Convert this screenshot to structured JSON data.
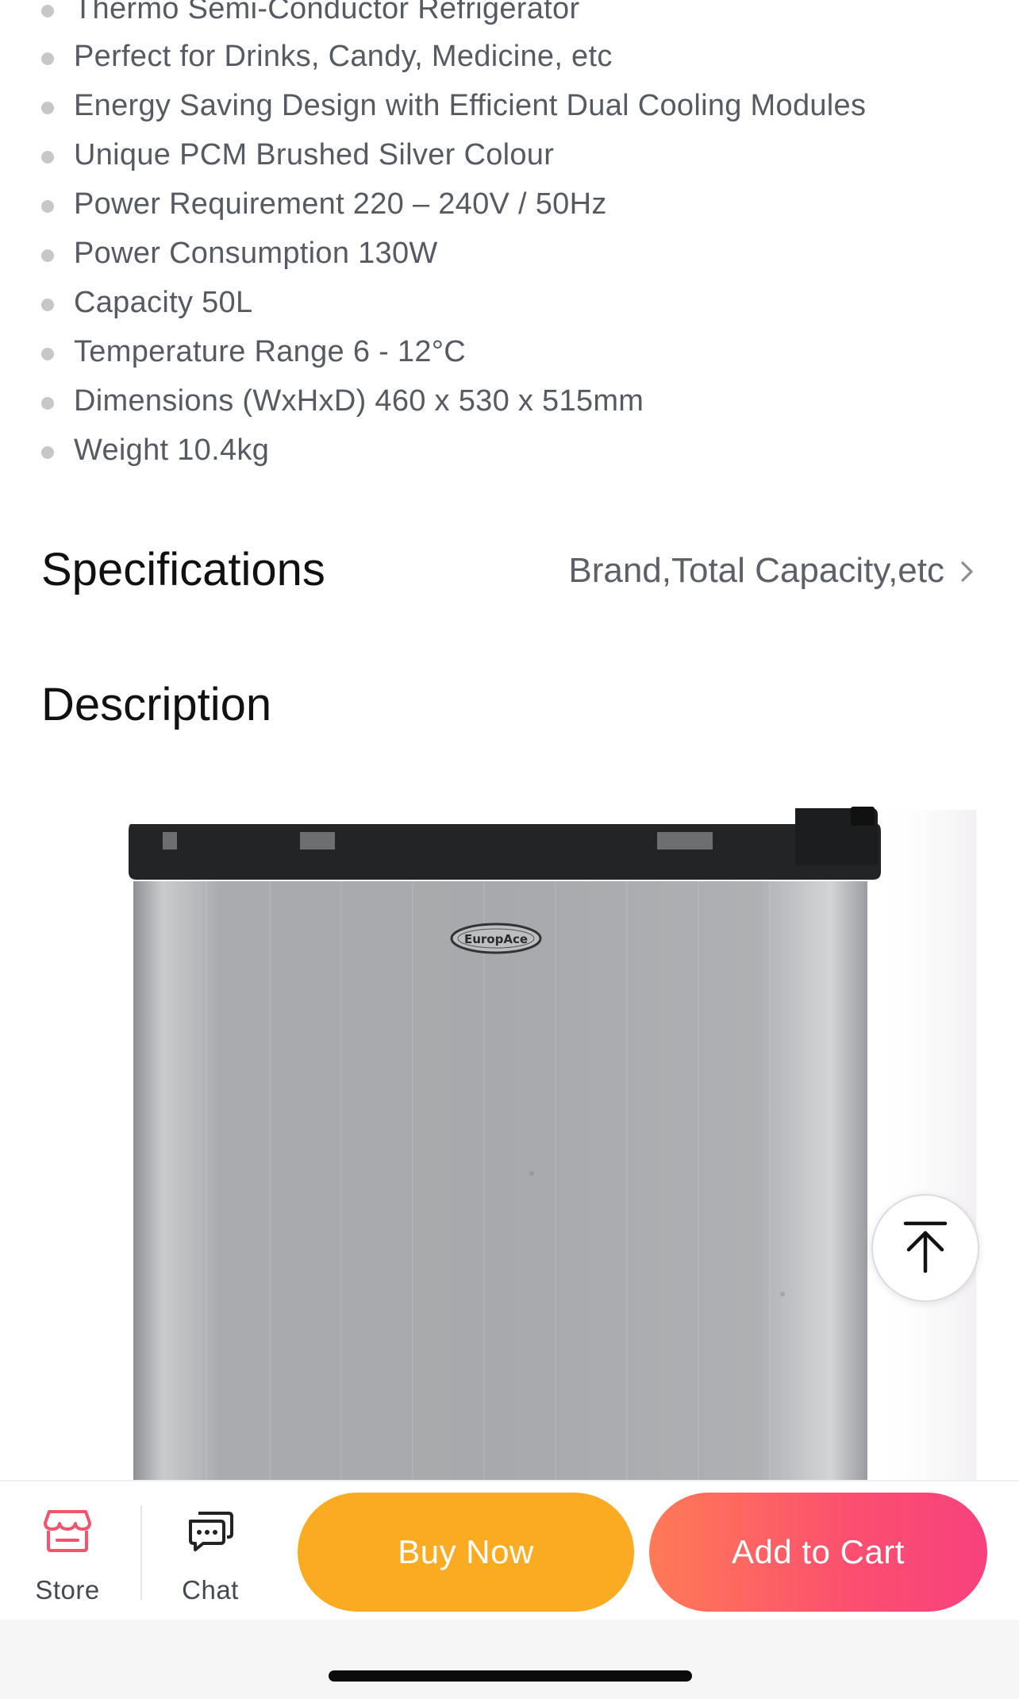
{
  "features": [
    "Thermo Semi-Conductor Refrigerator",
    "Perfect for Drinks, Candy, Medicine, etc",
    "Energy Saving Design with Efficient Dual Cooling Modules",
    "Unique PCM Brushed Silver Colour",
    "Power Requirement 220 – 240V / 50Hz",
    "Power Consumption 130W",
    "Capacity 50L",
    "Temperature Range 6 - 12°C",
    "Dimensions (WxHxD) 460 x 530 x 515mm",
    "Weight 10.4kg"
  ],
  "specifications": {
    "title": "Specifications",
    "summary": "Brand,Total Capacity,etc"
  },
  "description": {
    "title": "Description",
    "image": {
      "brand_logo_text": "EuropAce"
    }
  },
  "bottom_bar": {
    "store_label": "Store",
    "chat_label": "Chat",
    "buy_now_label": "Buy Now",
    "add_to_cart_label": "Add to Cart"
  },
  "icons": {
    "store": "store-icon",
    "chat": "chat-icon",
    "scroll_top": "arrow-up-to-top-icon",
    "chevron": "chevron-right-icon"
  },
  "colors": {
    "buy_now": "#fbab21",
    "add_to_cart_start": "#ff7a56",
    "add_to_cart_end": "#f7417e",
    "store_icon": "#f2536d"
  }
}
